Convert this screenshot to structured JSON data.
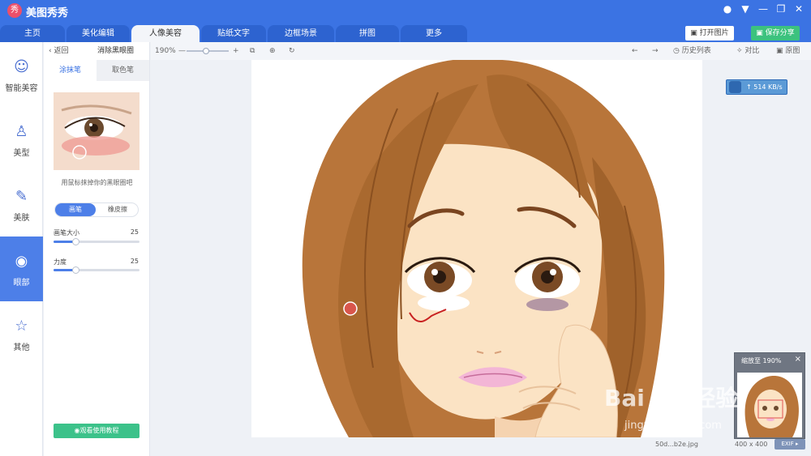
{
  "app": {
    "title": "美图秀秀",
    "logo_text": "秀"
  },
  "window_controls": [
    "●",
    "▼",
    "—",
    "❐",
    "✕"
  ],
  "tabs": [
    {
      "label": "主页"
    },
    {
      "label": "美化编辑"
    },
    {
      "label": "人像美容"
    },
    {
      "label": "贴纸文字"
    },
    {
      "label": "边框场景"
    },
    {
      "label": "拼图"
    },
    {
      "label": "更多"
    }
  ],
  "active_tab": "人像美容",
  "header_buttons": {
    "open": "打开图片",
    "save": "保存分享"
  },
  "leftnav": [
    {
      "label": "智能美容",
      "icon": "face-icon"
    },
    {
      "label": "美型",
      "icon": "person-icon"
    },
    {
      "label": "美肤",
      "icon": "brush-icon"
    },
    {
      "label": "眼部",
      "icon": "eye-icon"
    },
    {
      "label": "其他",
      "icon": "star-icon"
    }
  ],
  "active_nav": "眼部",
  "panel": {
    "back": "返回",
    "title": "消除黑眼圈",
    "subtabs": [
      "涂抹笔",
      "取色笔"
    ],
    "hint": "用鼠标抹掉你的黑眼圈吧",
    "modes": [
      "画笔",
      "橡皮擦"
    ],
    "sliders": [
      {
        "label": "画笔大小",
        "value": 25,
        "max": 100
      },
      {
        "label": "力度",
        "value": 25,
        "max": 100
      }
    ],
    "tutorial": "观看使用教程"
  },
  "toolbar": {
    "zoom": "190%",
    "zoom_out": "—",
    "zoom_in": "+",
    "undo": "←",
    "redo": "→",
    "history": "历史列表",
    "compare": "对比",
    "original": "原图"
  },
  "speed": "↑ 514 KB/s",
  "status": {
    "file": "50d...b2e.jpg",
    "size": "400 x 400",
    "exif": "EXIF ▸"
  },
  "zoom_popup": {
    "title": "缩放至 190%",
    "close": "×"
  },
  "watermark": {
    "main": "Bai du 经验",
    "sub": "jingyan.baidu.com"
  },
  "colors": {
    "accent": "#3b73e3",
    "active_nav": "#4d7fe8",
    "save": "#3cc27e",
    "hair": "#b8753a",
    "skin": "#fbe3c4"
  }
}
